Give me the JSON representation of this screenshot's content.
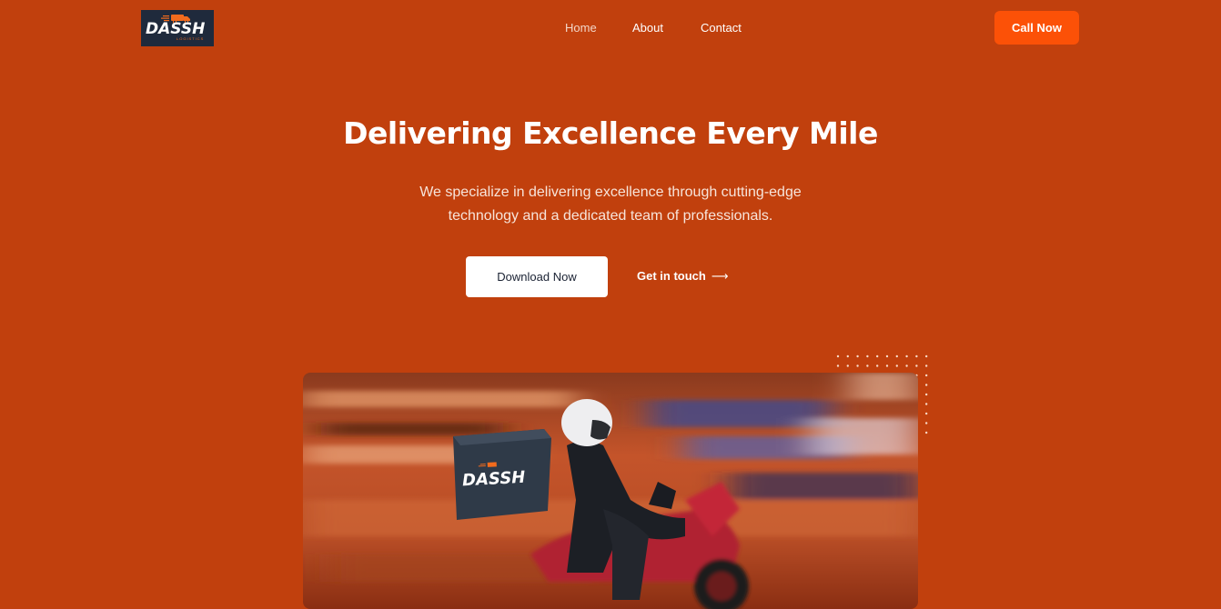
{
  "brand": {
    "name": "DASSH",
    "tagline": "LOGISTICS",
    "colors": {
      "background": "#c1400d",
      "accent": "#fc5107",
      "logo_bg": "#1f2a3c"
    }
  },
  "nav": {
    "items": [
      {
        "label": "Home",
        "active": true
      },
      {
        "label": "About",
        "active": false
      },
      {
        "label": "Contact",
        "active": false
      }
    ],
    "cta_label": "Call Now"
  },
  "hero": {
    "title": "Delivering Excellence Every Mile",
    "subtitle": "We specialize in delivering excellence through cutting-edge technology and a dedicated team of professionals.",
    "primary_button": "Download Now",
    "secondary_link": "Get in touch",
    "secondary_icon": "long-arrow-right-icon",
    "image_box_label": "DASSH"
  }
}
